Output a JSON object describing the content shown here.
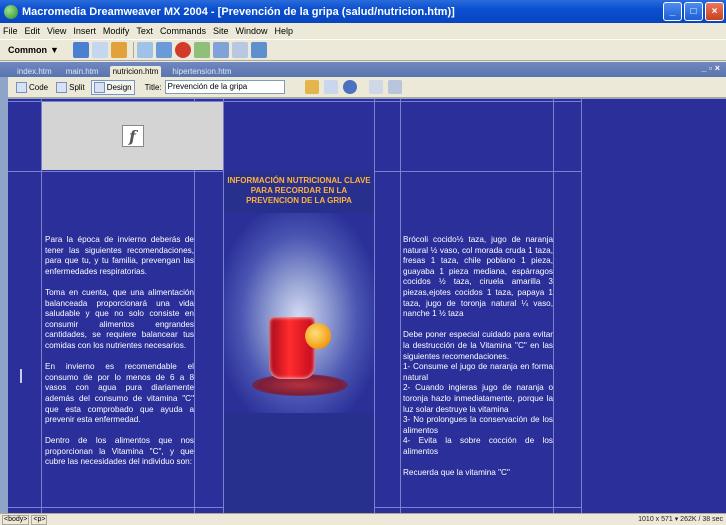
{
  "window": {
    "title": "Macromedia Dreamweaver MX 2004 - [Prevención de la gripa (salud/nutricion.htm)]"
  },
  "menu": [
    "File",
    "Edit",
    "View",
    "Insert",
    "Modify",
    "Text",
    "Commands",
    "Site",
    "Window",
    "Help"
  ],
  "insert_bar": {
    "category": "Common"
  },
  "doc_tabs": [
    {
      "label": "index.htm",
      "active": false
    },
    {
      "label": "main.htm",
      "active": false
    },
    {
      "label": "nutricion.htm",
      "active": true
    },
    {
      "label": "hipertension.htm",
      "active": false
    }
  ],
  "doc_toolbar": {
    "code_label": "Code",
    "split_label": "Split",
    "design_label": "Design",
    "title_label": "Title:",
    "title_value": "Prevención de la gripa"
  },
  "page": {
    "heading": "INFORMACIÓN NUTRICIONAL CLAVE PARA RECORDAR EN LA PREVENCION DE LA GRIPA",
    "left_paragraphs": [
      "Para la época de invierno deberás de tener las siguientes recomendaciones, para que tu, y tu familia, prevengan las enfermedades respiratorias.",
      "Toma en cuenta, que una alimentación balanceada proporcionará una vida saludable y que no solo consiste en consumir alimentos engrandes cantidades, se requiere balancear tus comidas con los nutrientes necesarios.",
      "En invierno es recomendable el consumo de por lo menos de 6 a 8 vasos con agua pura diariamente además del consumo de vitamina \"C\" que esta comprobado que ayuda a prevenir esta enfermedad.",
      "Dentro de los alimentos que nos proporcionan la Vitamina \"C\", y que cubre las necesidades del individuo son:"
    ],
    "right_paragraphs": [
      "Brócoli cocido½ taza, jugo de naranja natural ½ vaso, col morada cruda 1 taza, fresas 1 taza, chile poblano 1 pieza, guayaba 1 pieza mediana, espárragos cocidos ½ taza, ciruela amarilla 3 piezas,ejotes cocidos 1 taza, papaya 1 taza, jugo de toronja natural ¼ vaso, nanche 1 ½ taza",
      "Debe poner especial cuidado para evitar la destrucción de la Vitamina \"C\" en las siguientes recomendaciones.",
      "1- Consume el jugo de naranja en forma natural",
      "2- Cuando ingieras jugo de naranja o toronja hazlo inmediatamente, porque la luz solar destruye la vitamina",
      "3- No prolongues la conservación de los alimentos",
      "4- Evita la sobre cocción de los alimentos",
      "Recuerda que la vitamina \"C\""
    ]
  },
  "status": {
    "tags": [
      "<body>",
      "<p>"
    ],
    "info": "1010 x 571 ▾ 262K / 38 sec"
  },
  "colors": {
    "design_bg": "#2b2f9a",
    "heading": "#ffb23a",
    "guides": "#7a7fd0"
  }
}
